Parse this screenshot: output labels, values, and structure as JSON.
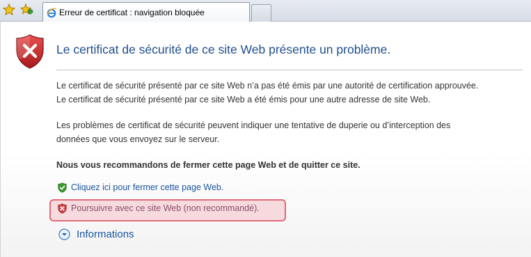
{
  "toolbar": {
    "favorites_icon": "star-icon",
    "add_favorites_icon": "add-favorite-icon"
  },
  "tab": {
    "title": "Erreur de certificat : navigation bloquée",
    "icon": "ie-icon"
  },
  "page": {
    "headline": "Le certificat de sécurité de ce site Web présente un problème.",
    "paragraph1_line1": "Le certificat de sécurité présenté par ce site Web n’a pas été émis par une autorité de certification approuvée.",
    "paragraph1_line2": "Le certificat de sécurité présenté par ce site Web a été émis pour une autre adresse de site Web.",
    "paragraph2_line1": "Les problèmes de certificat de sécurité peuvent indiquer une tentative de duperie ou d’interception des",
    "paragraph2_line2": "données que vous envoyez sur le serveur.",
    "recommendation": "Nous vous recommandons de fermer cette page Web et de quitter ce site.",
    "close_link": "Cliquez ici pour fermer cette page Web.",
    "continue_link": "Poursuivre avec ce site Web (non recommandé).",
    "more_info": "Informations"
  },
  "colors": {
    "headline": "#1f4e8c",
    "link": "#1a56a0",
    "highlight_border": "#e06b78",
    "highlight_fill": "#f6dadd",
    "shield_red": "#c8272d",
    "shield_green": "#3e9a2f"
  }
}
